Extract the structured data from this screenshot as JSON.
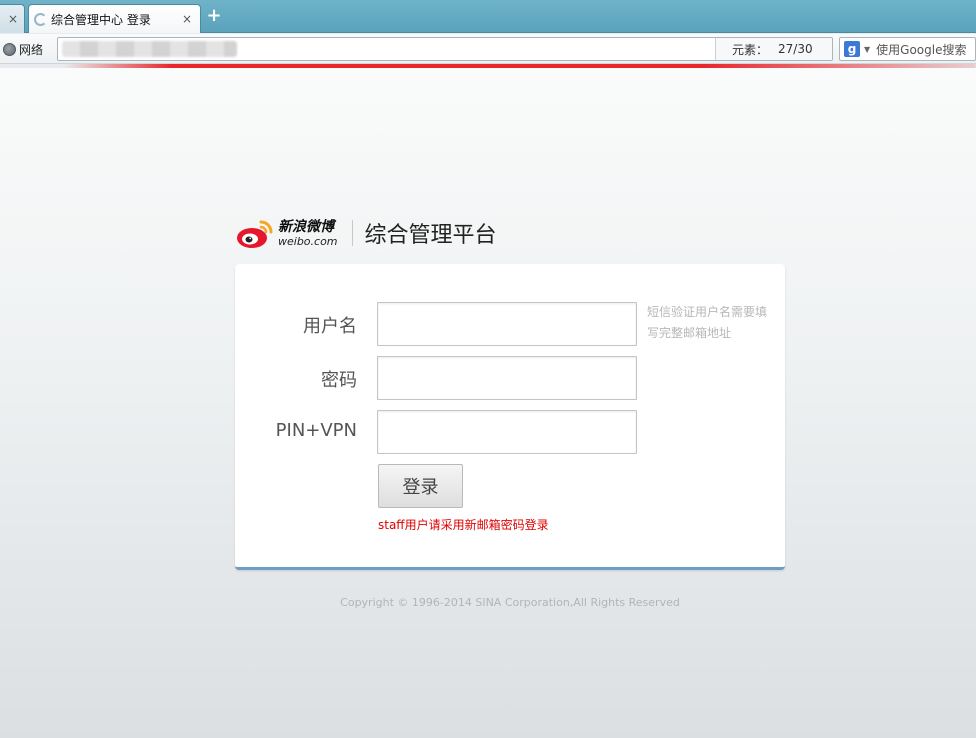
{
  "browser": {
    "tab_title": "综合管理中心 登录",
    "tab_close": "×",
    "new_tab": "+",
    "network_label": "网络",
    "element_label": "元素：",
    "element_count": "27/30",
    "search_engine_badge": "g",
    "search_placeholder": "使用Google搜索",
    "loading_color": "#e8262c"
  },
  "brand": {
    "logo_cn": "新浪微博",
    "logo_en": "weibo.com",
    "title": "综合管理平台",
    "logo_colors": {
      "red": "#e6162d",
      "orange": "#f6a623"
    }
  },
  "form": {
    "username_label": "用户名",
    "password_label": "密码",
    "pin_label": "PIN+VPN",
    "username_value": "",
    "password_value": "",
    "pin_value": "",
    "hint": "短信验证用户名需要填写完整邮箱地址",
    "login_button": "登录",
    "notice": "staff用户请采用新邮箱密码登录",
    "notice_color": "#e00000"
  },
  "footer": {
    "copyright": "Copyright © 1996-2014 SINA Corporation,All Rights Reserved"
  }
}
